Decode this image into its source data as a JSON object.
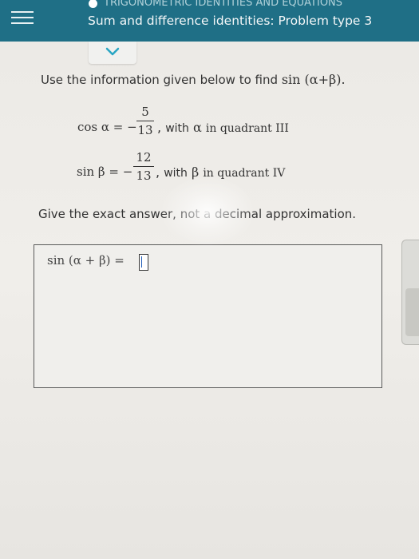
{
  "header": {
    "topic": "TRIGONOMETRIC IDENTITIES AND EQUATIONS",
    "title": "Sum and difference identities: Problem type 3",
    "colors": {
      "bar": "#1f6f86",
      "accent": "#2aa6c4"
    }
  },
  "icons": {
    "menu": "hamburger-icon",
    "collapse": "chevron-down-icon"
  },
  "question": {
    "intro": "Use the information given below to find",
    "target": "sin (α+β).",
    "given": [
      {
        "lhs": "cos α = −",
        "numerator": "5",
        "denominator": "13",
        "comma": ",",
        "condition_text": "with",
        "condition_var": "α",
        "condition_rest": "in quadrant III"
      },
      {
        "lhs": "sin β = −",
        "numerator": "12",
        "denominator": "13",
        "comma": ",",
        "condition_text": "with",
        "condition_var": "β",
        "condition_rest": "in quadrant IV"
      }
    ],
    "note": "Give the exact answer, not a decimal approximation."
  },
  "answer": {
    "expression": "sin (α + β) =",
    "value": ""
  }
}
